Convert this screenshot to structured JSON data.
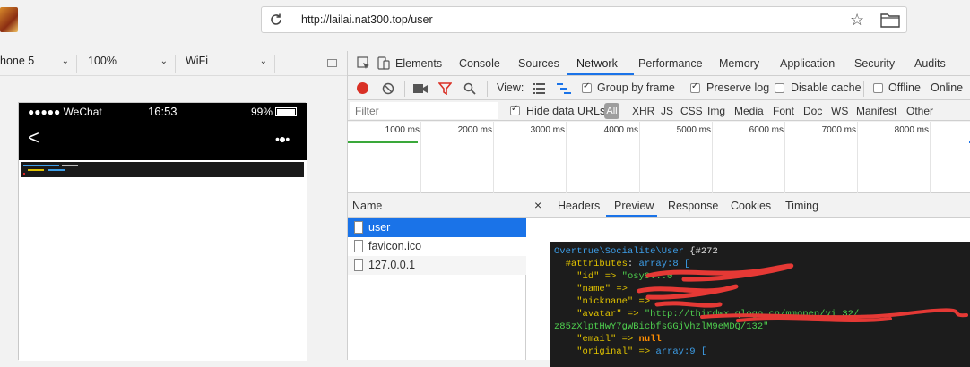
{
  "address_bar": {
    "url": "http://lailai.nat300.top/user",
    "reload_icon": "reload-icon",
    "star_icon": "star-icon",
    "folder_icon": "folder-icon"
  },
  "device_toolbar": {
    "device": "hone 5",
    "zoom": "100%",
    "network": "WiFi"
  },
  "phone": {
    "status_carrier": "●●●●● WeChat",
    "status_time": "16:53",
    "status_battery": "99%",
    "nav_back": "<",
    "nav_more": "•●•"
  },
  "devtools": {
    "tabs": [
      "Elements",
      "Console",
      "Sources",
      "Network",
      "Performance",
      "Memory",
      "Application",
      "Security",
      "Audits"
    ],
    "active_tab": "Network",
    "toolbar": {
      "view_label": "View:",
      "group_by_frame": "Group by frame",
      "preserve_log": "Preserve log",
      "disable_cache": "Disable cache",
      "offline": "Offline",
      "online": "Online"
    },
    "filter": {
      "placeholder": "Filter",
      "hide_data_urls": "Hide data URLs",
      "all": "All",
      "types": [
        "XHR",
        "JS",
        "CSS",
        "Img",
        "Media",
        "Font",
        "Doc",
        "WS",
        "Manifest",
        "Other"
      ]
    },
    "timeline_ticks": [
      "1000 ms",
      "2000 ms",
      "3000 ms",
      "4000 ms",
      "5000 ms",
      "6000 ms",
      "7000 ms",
      "8000 ms"
    ],
    "name_header": "Name",
    "requests": [
      "user",
      "favicon.ico",
      "127.0.0.1"
    ],
    "selected_request": "user",
    "preview_tabs": [
      "Headers",
      "Preview",
      "Response",
      "Cookies",
      "Timing"
    ],
    "active_preview_tab": "Preview",
    "close_symbol": "×",
    "dump": {
      "class_name": "Overtrue\\Socialite\\User",
      "object_id": "{#272",
      "attributes_key": "#attributes",
      "attributes_type": "array:8 [",
      "id_key": "\"id\" => ",
      "id_val": "\"osy9...0",
      "name_key": "\"name\" => ",
      "nickname_key": "\"nickname\" => ",
      "avatar_key": "\"avatar\" => ",
      "avatar_val": "\"http://thirdwx.qlogo.cn/mmopen/vi_32/...",
      "avatar_cont": "z85zXlptHwY7gWBicbfsGGjVhzlM9eMDQ/132\"",
      "email_key": "\"email\" => ",
      "email_val": "null",
      "original_key": "\"original\" => ",
      "original_type": "array:9 ["
    }
  }
}
